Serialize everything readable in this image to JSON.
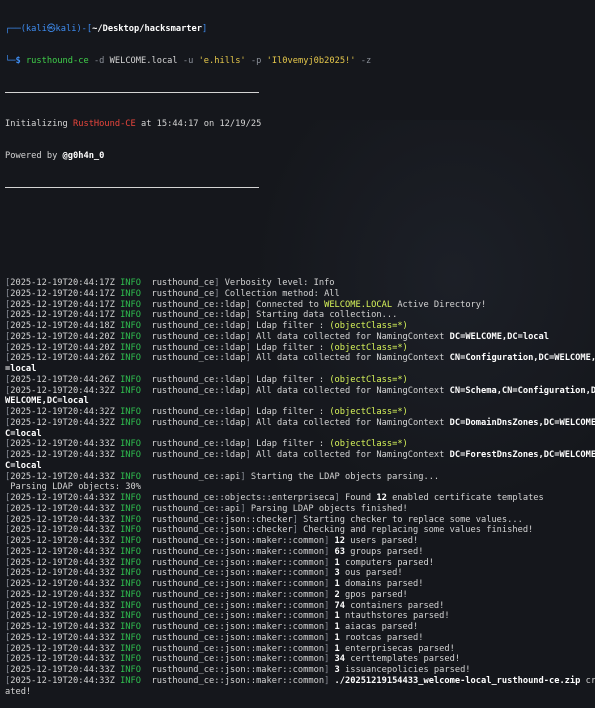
{
  "prompt": {
    "user": "kali",
    "at": "㉿",
    "host": "kali",
    "path": "~/Desktop/hacksmarter",
    "command": "rusthound-ce",
    "flag_d": "-d",
    "domain": "WELCOME.local",
    "flag_u": "-u",
    "username": "'e.hills'",
    "flag_p": "-p",
    "password": "'Il0vemyj0b2025!'",
    "flag_z": "-z"
  },
  "banner": {
    "init_prefix": "Initializing ",
    "tool": "RustHound-CE",
    "init_suffix": " at 15:44:17 on 12/19/25",
    "powered_prefix": "Powered by ",
    "author": "@g0h4n_0"
  },
  "log": [
    {
      "ts": "2025-12-19T20:44:17Z",
      "level": "INFO",
      "mod": "rusthound_ce",
      "msg": "Verbosity level: Info"
    },
    {
      "ts": "2025-12-19T20:44:17Z",
      "level": "INFO",
      "mod": "rusthound_ce",
      "msg": "Collection method: All"
    },
    {
      "ts": "2025-12-19T20:44:17Z",
      "level": "INFO",
      "mod": "rusthound_ce::ldap",
      "pre": "Connected to ",
      "hl": "WELCOME.LOCAL",
      "post": " Active Directory!"
    },
    {
      "ts": "2025-12-19T20:44:17Z",
      "level": "INFO",
      "mod": "rusthound_ce::ldap",
      "msg": "Starting data collection..."
    },
    {
      "ts": "2025-12-19T20:44:18Z",
      "level": "INFO",
      "mod": "rusthound_ce::ldap",
      "pre": "Ldap filter : ",
      "hl": "(objectClass=*)"
    },
    {
      "ts": "2025-12-19T20:44:20Z",
      "level": "INFO",
      "mod": "rusthound_ce::ldap",
      "pre": "All data collected for NamingContext ",
      "b": "DC=WELCOME,DC=local"
    },
    {
      "ts": "2025-12-19T20:44:20Z",
      "level": "INFO",
      "mod": "rusthound_ce::ldap",
      "pre": "Ldap filter : ",
      "hl": "(objectClass=*)"
    },
    {
      "ts": "2025-12-19T20:44:26Z",
      "level": "INFO",
      "mod": "rusthound_ce::ldap",
      "pre": "All data collected for NamingContext ",
      "b": "CN=Configuration,DC=WELCOME,DC",
      "cont": "=local"
    },
    {
      "ts": "2025-12-19T20:44:26Z",
      "level": "INFO",
      "mod": "rusthound_ce::ldap",
      "pre": "Ldap filter : ",
      "hl": "(objectClass=*)"
    },
    {
      "ts": "2025-12-19T20:44:32Z",
      "level": "INFO",
      "mod": "rusthound_ce::ldap",
      "pre": "All data collected for NamingContext ",
      "b": "CN=Schema,CN=Configuration,DC=",
      "cont": "WELCOME,DC=local"
    },
    {
      "ts": "2025-12-19T20:44:32Z",
      "level": "INFO",
      "mod": "rusthound_ce::ldap",
      "pre": "Ldap filter : ",
      "hl": "(objectClass=*)"
    },
    {
      "ts": "2025-12-19T20:44:32Z",
      "level": "INFO",
      "mod": "rusthound_ce::ldap",
      "pre": "All data collected for NamingContext ",
      "b": "DC=DomainDnsZones,DC=WELCOME,D",
      "cont": "C=local"
    },
    {
      "ts": "2025-12-19T20:44:33Z",
      "level": "INFO",
      "mod": "rusthound_ce::ldap",
      "pre": "Ldap filter : ",
      "hl": "(objectClass=*)"
    },
    {
      "ts": "2025-12-19T20:44:33Z",
      "level": "INFO",
      "mod": "rusthound_ce::ldap",
      "pre": "All data collected for NamingContext ",
      "b": "DC=ForestDnsZones,DC=WELCOME,D",
      "cont": "C=local"
    },
    {
      "ts": "2025-12-19T20:44:33Z",
      "level": "INFO",
      "mod": "rusthound_ce::api",
      "msg": "Starting the LDAP objects parsing..."
    },
    {
      "raw": " Parsing LDAP objects: 30%"
    },
    {
      "ts": "2025-12-19T20:44:33Z",
      "level": "INFO",
      "mod": "rusthound_ce::objects::enterpriseca",
      "pre": "Found ",
      "b": "12",
      "post": " enabled certificate templates"
    },
    {
      "ts": "2025-12-19T20:44:33Z",
      "level": "INFO",
      "mod": "rusthound_ce::api",
      "msg": "Parsing LDAP objects finished!"
    },
    {
      "ts": "2025-12-19T20:44:33Z",
      "level": "INFO",
      "mod": "rusthound_ce::json::checker",
      "msg": "Starting checker to replace some values..."
    },
    {
      "ts": "2025-12-19T20:44:33Z",
      "level": "INFO",
      "mod": "rusthound_ce::json::checker",
      "msg": "Checking and replacing some values finished!"
    },
    {
      "ts": "2025-12-19T20:44:33Z",
      "level": "INFO",
      "mod": "rusthound_ce::json::maker::common",
      "b": "12",
      "post": " users parsed!"
    },
    {
      "ts": "2025-12-19T20:44:33Z",
      "level": "INFO",
      "mod": "rusthound_ce::json::maker::common",
      "b": "63",
      "post": " groups parsed!"
    },
    {
      "ts": "2025-12-19T20:44:33Z",
      "level": "INFO",
      "mod": "rusthound_ce::json::maker::common",
      "b": "1",
      "post": " computers parsed!"
    },
    {
      "ts": "2025-12-19T20:44:33Z",
      "level": "INFO",
      "mod": "rusthound_ce::json::maker::common",
      "b": "3",
      "post": " ous parsed!"
    },
    {
      "ts": "2025-12-19T20:44:33Z",
      "level": "INFO",
      "mod": "rusthound_ce::json::maker::common",
      "b": "1",
      "post": " domains parsed!"
    },
    {
      "ts": "2025-12-19T20:44:33Z",
      "level": "INFO",
      "mod": "rusthound_ce::json::maker::common",
      "b": "2",
      "post": " gpos parsed!"
    },
    {
      "ts": "2025-12-19T20:44:33Z",
      "level": "INFO",
      "mod": "rusthound_ce::json::maker::common",
      "b": "74",
      "post": " containers parsed!"
    },
    {
      "ts": "2025-12-19T20:44:33Z",
      "level": "INFO",
      "mod": "rusthound_ce::json::maker::common",
      "b": "1",
      "post": " ntauthstores parsed!"
    },
    {
      "ts": "2025-12-19T20:44:33Z",
      "level": "INFO",
      "mod": "rusthound_ce::json::maker::common",
      "b": "1",
      "post": " aiacas parsed!"
    },
    {
      "ts": "2025-12-19T20:44:33Z",
      "level": "INFO",
      "mod": "rusthound_ce::json::maker::common",
      "b": "1",
      "post": " rootcas parsed!"
    },
    {
      "ts": "2025-12-19T20:44:33Z",
      "level": "INFO",
      "mod": "rusthound_ce::json::maker::common",
      "b": "1",
      "post": " enterprisecas parsed!"
    },
    {
      "ts": "2025-12-19T20:44:33Z",
      "level": "INFO",
      "mod": "rusthound_ce::json::maker::common",
      "b": "34",
      "post": " certtemplates parsed!"
    },
    {
      "ts": "2025-12-19T20:44:33Z",
      "level": "INFO",
      "mod": "rusthound_ce::json::maker::common",
      "b": "3",
      "post": " issuancepolicies parsed!"
    },
    {
      "ts": "2025-12-19T20:44:33Z",
      "level": "INFO",
      "mod": "rusthound_ce::json::maker::common",
      "b": "./20251219154433_welcome-local_rusthound-ce.zip",
      "post": " cre",
      "cont_plain": "ated!"
    }
  ]
}
